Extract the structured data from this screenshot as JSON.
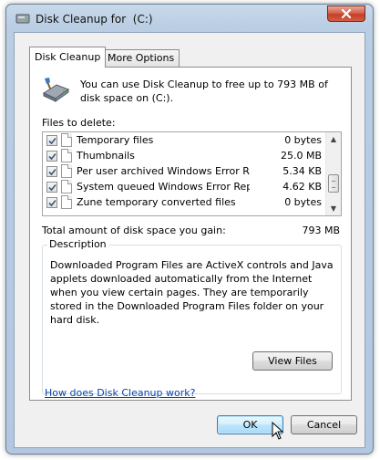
{
  "window": {
    "title": "Disk Cleanup for  (C:)",
    "close_label": "✕"
  },
  "tabs": [
    {
      "label": "Disk Cleanup",
      "active": true
    },
    {
      "label": "More Options",
      "active": false
    }
  ],
  "intro": {
    "text": "You can use Disk Cleanup to free up to 793 MB of disk space on  (C:).",
    "icon": "disk-cleanup-icon"
  },
  "files": {
    "label": "Files to delete:",
    "items": [
      {
        "name": "Temporary files",
        "size": "0 bytes",
        "checked": true
      },
      {
        "name": "Thumbnails",
        "size": "25.0 MB",
        "checked": true
      },
      {
        "name": "Per user archived Windows Error Repo...",
        "size": "5.34 KB",
        "checked": true
      },
      {
        "name": "System queued Windows Error Reporti...",
        "size": "4.62 KB",
        "checked": true
      },
      {
        "name": "Zune temporary converted files",
        "size": "0 bytes",
        "checked": true
      }
    ]
  },
  "total": {
    "label": "Total amount of disk space you gain:",
    "value": "793 MB"
  },
  "description": {
    "legend": "Description",
    "text": "Downloaded Program Files are ActiveX controls and Java applets downloaded automatically from the Internet when you view certain pages. They are temporarily stored in the Downloaded Program Files folder on your hard disk.",
    "view_button": "View Files"
  },
  "help_link": "How does Disk Cleanup work?",
  "buttons": {
    "ok": "OK",
    "cancel": "Cancel"
  },
  "colors": {
    "link": "#0645ad",
    "check": "#3c5a7c",
    "frame": "#b9cde3"
  }
}
